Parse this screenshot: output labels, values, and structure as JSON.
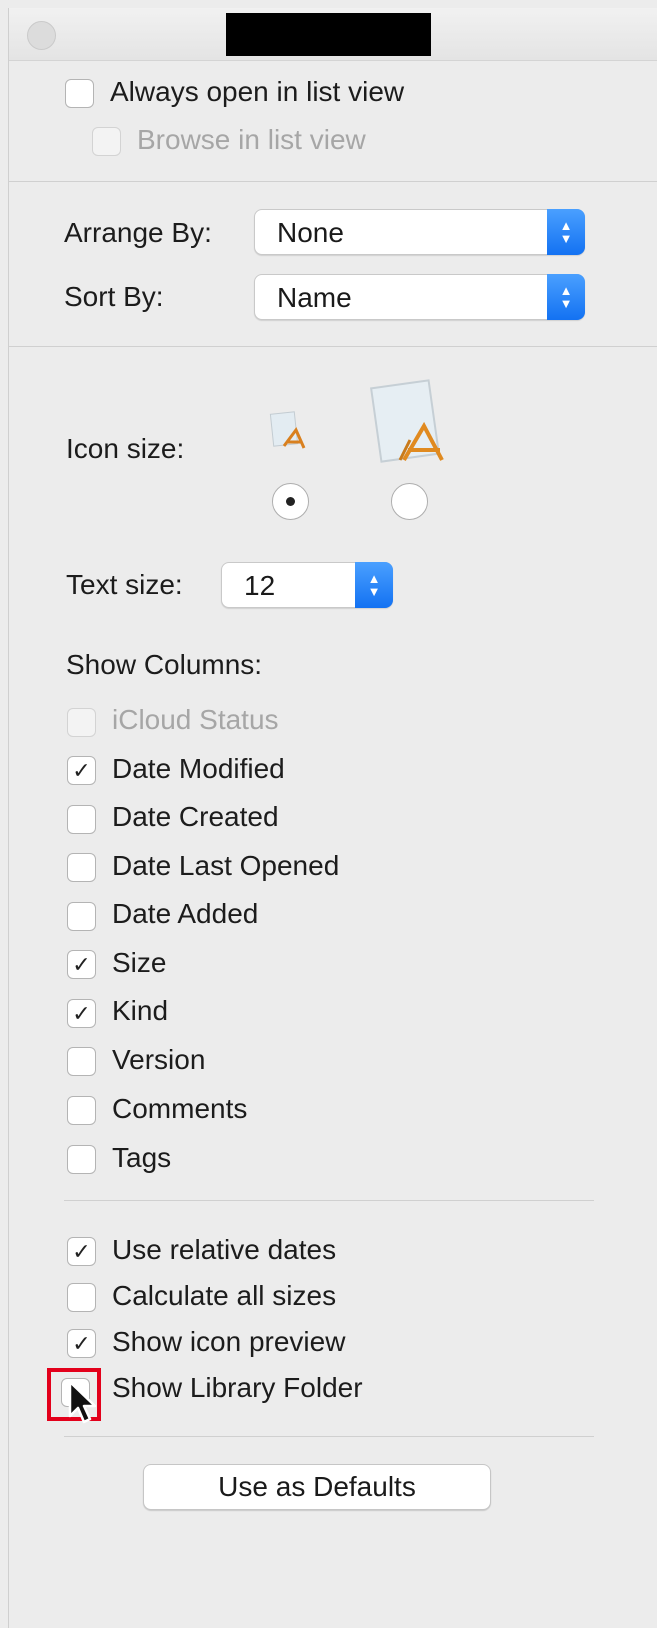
{
  "window": {
    "title_redacted": true
  },
  "view_options": {
    "always_open_list": {
      "label": "Always open in list view",
      "checked": false
    },
    "browse_list": {
      "label": "Browse in list view",
      "checked": false,
      "enabled": false
    }
  },
  "arrange": {
    "label": "Arrange By:",
    "value": "None"
  },
  "sort": {
    "label": "Sort By:",
    "value": "Name"
  },
  "icon_size": {
    "label": "Icon size:",
    "selected": "small"
  },
  "text_size": {
    "label": "Text size:",
    "value": "12"
  },
  "columns": {
    "heading": "Show Columns:",
    "items": [
      {
        "label": "iCloud Status",
        "checked": false,
        "enabled": false
      },
      {
        "label": "Date Modified",
        "checked": true
      },
      {
        "label": "Date Created",
        "checked": false
      },
      {
        "label": "Date Last Opened",
        "checked": false
      },
      {
        "label": "Date Added",
        "checked": false
      },
      {
        "label": "Size",
        "checked": true
      },
      {
        "label": "Kind",
        "checked": true
      },
      {
        "label": "Version",
        "checked": false
      },
      {
        "label": "Comments",
        "checked": false
      },
      {
        "label": "Tags",
        "checked": false
      }
    ]
  },
  "options": {
    "items": [
      {
        "label": "Use relative dates",
        "checked": true
      },
      {
        "label": "Calculate all sizes",
        "checked": false
      },
      {
        "label": "Show icon preview",
        "checked": true
      },
      {
        "label": "Show Library Folder",
        "checked": false
      }
    ]
  },
  "defaults_button": {
    "label": "Use as Defaults"
  },
  "colors": {
    "accent": "#1372f2",
    "highlight": "#e3001b",
    "window_bg": "#ececec"
  }
}
